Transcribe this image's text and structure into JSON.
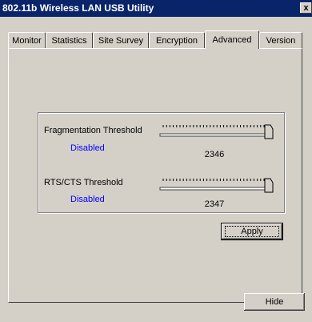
{
  "window": {
    "title": "802.11b Wireless LAN USB Utility",
    "close_label": "x"
  },
  "tabs": [
    {
      "label": "Monitor",
      "active": false
    },
    {
      "label": "Statistics",
      "active": false
    },
    {
      "label": "Site Survey",
      "active": false
    },
    {
      "label": "Encryption",
      "active": false
    },
    {
      "label": "Advanced",
      "active": true
    },
    {
      "label": "Version",
      "active": false
    }
  ],
  "advanced": {
    "fragmentation": {
      "label": "Fragmentation Threshold",
      "status": "Disabled",
      "value": "2346",
      "slider_level": 1.0
    },
    "rts_cts": {
      "label": "RTS/CTS Threshold",
      "status": "Disabled",
      "value": "2347",
      "slider_level": 1.0
    },
    "apply_label": "Apply"
  },
  "footer": {
    "hide_label": "Hide"
  },
  "colors": {
    "titlebar": "#0a246a",
    "face": "#d4d0c8",
    "status_text": "#0000ff"
  }
}
